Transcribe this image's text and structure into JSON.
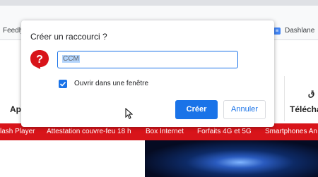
{
  "bookmarks": {
    "left_label": "Feedly",
    "right_label": "Dashlane",
    "google_icon": "google-docs-icon"
  },
  "dialog": {
    "title": "Créer un raccourci ?",
    "site_icon": "ccm-question-icon",
    "name_value": "CCM",
    "checkbox_label": "Ouvrir dans une fenêtre",
    "checkbox_checked": true,
    "create_label": "Créer",
    "cancel_label": "Annuler"
  },
  "nav": {
    "left_label": "Ap",
    "right_label": "Télécha",
    "right_top_label": "ق"
  },
  "redbar": {
    "items": [
      "lash Player",
      "Attestation couvre-feu 18 h",
      "Box Internet",
      "Forfaits 4G et 5G",
      "Smartphones An"
    ]
  },
  "colors": {
    "accent": "#1a73e8",
    "redbar": "#d8141a"
  }
}
